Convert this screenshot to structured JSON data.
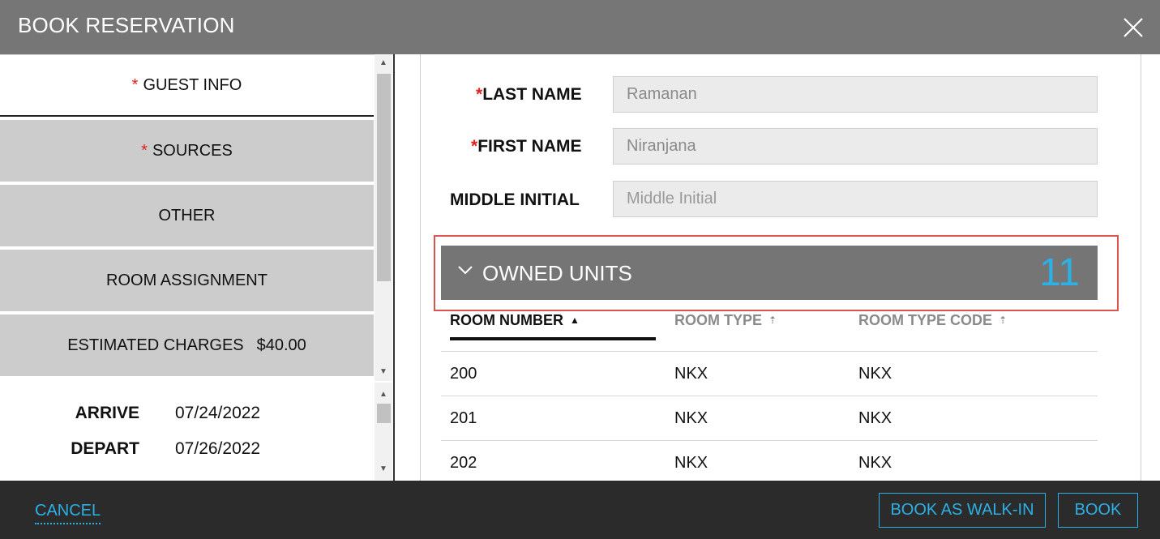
{
  "header": {
    "title": "BOOK RESERVATION",
    "close_icon": "close-icon"
  },
  "nav": {
    "required_marker": "*",
    "items": [
      {
        "label": "GUEST INFO",
        "required": true,
        "active": true
      },
      {
        "label": "SOURCES",
        "required": true,
        "active": false
      },
      {
        "label": "OTHER",
        "required": false,
        "active": false
      },
      {
        "label": "ROOM ASSIGNMENT",
        "required": false,
        "active": false
      },
      {
        "label": "ESTIMATED CHARGES",
        "amount": "$40.00",
        "required": false,
        "active": false
      }
    ]
  },
  "dates": {
    "arrive_label": "ARRIVE",
    "arrive_value": "07/24/2022",
    "depart_label": "DEPART",
    "depart_value": "07/26/2022"
  },
  "form": {
    "last_name": {
      "label": "LAST NAME",
      "value": "Ramanan",
      "required": true
    },
    "first_name": {
      "label": "FIRST NAME",
      "value": "Niranjana",
      "required": true
    },
    "middle_initial": {
      "label": "MIDDLE INITIAL",
      "value": "",
      "placeholder": "Middle Initial"
    }
  },
  "owned_units": {
    "title": "OWNED UNITS",
    "count": "11",
    "columns": [
      {
        "label": "ROOM NUMBER",
        "sort": "ascending"
      },
      {
        "label": "ROOM TYPE",
        "sort": "none"
      },
      {
        "label": "ROOM TYPE CODE",
        "sort": "none"
      }
    ],
    "rows": [
      [
        "200",
        "NKX",
        "NKX"
      ],
      [
        "201",
        "NKX",
        "NKX"
      ],
      [
        "202",
        "NKX",
        "NKX"
      ]
    ]
  },
  "footer": {
    "cancel_label": "CANCEL",
    "walk_in_label": "BOOK AS WALK-IN",
    "book_label": "BOOK"
  },
  "colors": {
    "header_bg": "#767676",
    "accent": "#2bb1e6",
    "required": "#e0201b",
    "highlight_border": "#d9534f",
    "footer_bg": "#2b2b2b"
  }
}
